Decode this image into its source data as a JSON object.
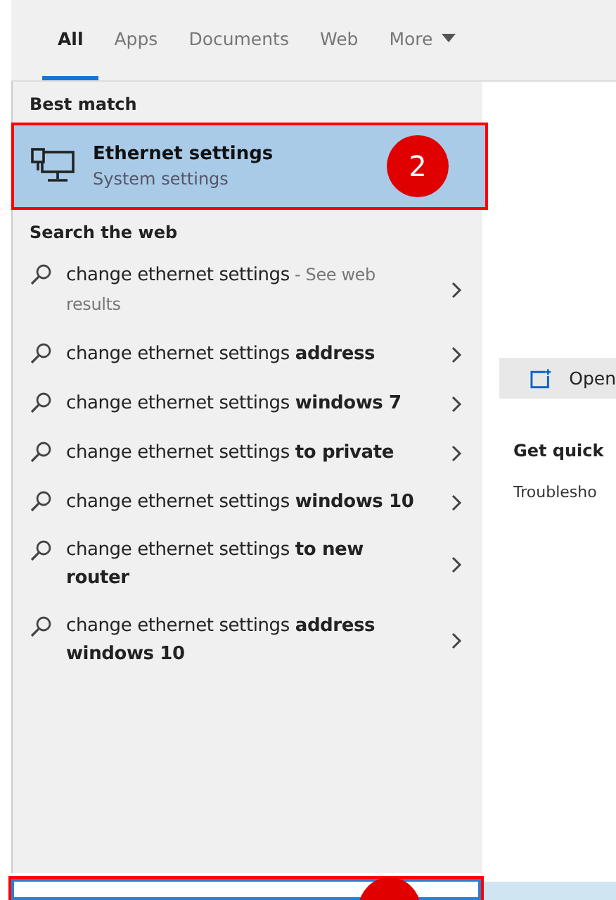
{
  "tabs": [
    {
      "label": "All",
      "selected": true
    },
    {
      "label": "Apps",
      "selected": false
    },
    {
      "label": "Documents",
      "selected": false
    },
    {
      "label": "Web",
      "selected": false
    },
    {
      "label": "More",
      "selected": false,
      "dropdown": true
    }
  ],
  "best_match": {
    "heading": "Best match",
    "title": "Ethernet settings",
    "subtitle": "System settings",
    "selected": true,
    "badge": "2"
  },
  "web": {
    "heading": "Search the web",
    "results": [
      {
        "text": "change ethernet settings",
        "hint": " - See web results"
      },
      {
        "text": "change ethernet settings **address**"
      },
      {
        "text": "change ethernet settings **windows 7**"
      },
      {
        "text": "change ethernet settings **to private**"
      },
      {
        "text": "change ethernet settings **windows 10**"
      },
      {
        "text": "change ethernet settings **to new router**"
      },
      {
        "text": "change ethernet settings **address windows 10**"
      }
    ]
  },
  "preview": {
    "open_label": "Open",
    "quick_heading": "Get quick",
    "quick_item": "Troublesho"
  }
}
